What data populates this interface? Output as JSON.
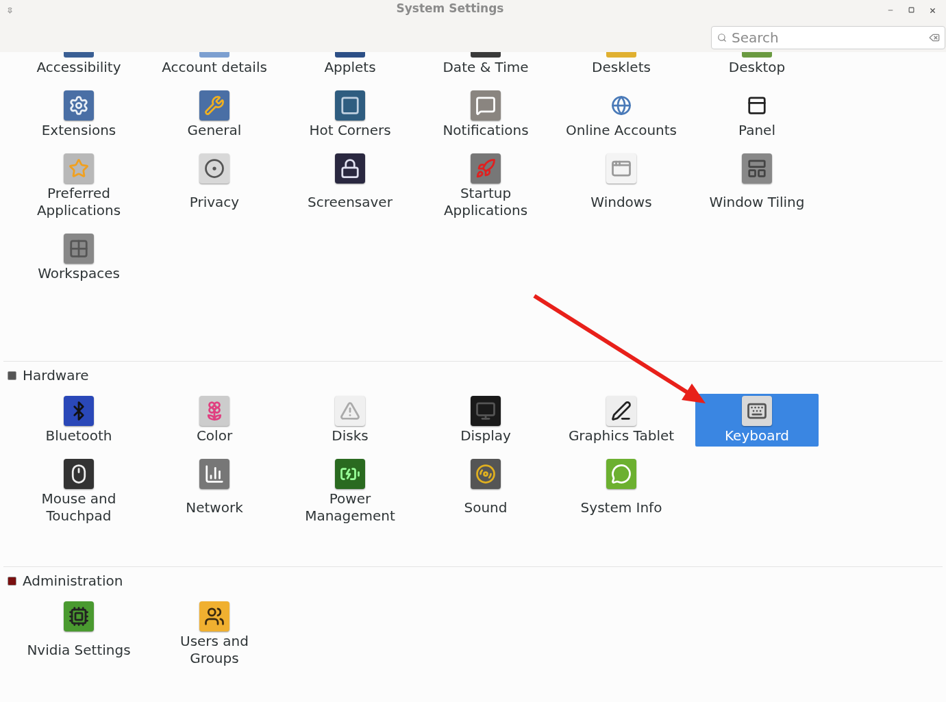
{
  "window": {
    "title": "System Settings"
  },
  "search": {
    "placeholder": "Search"
  },
  "sections": [
    {
      "items": [
        {
          "label": "Accessibility",
          "selected": false
        },
        {
          "label": "Account details",
          "selected": false
        },
        {
          "label": "Applets",
          "selected": false
        },
        {
          "label": "Date & Time",
          "selected": false
        },
        {
          "label": "Desklets",
          "selected": false
        },
        {
          "label": "Desktop",
          "selected": false
        },
        {
          "label": "Extensions",
          "selected": false
        },
        {
          "label": "General",
          "selected": false
        },
        {
          "label": "Hot Corners",
          "selected": false
        },
        {
          "label": "Notifications",
          "selected": false
        },
        {
          "label": "Online Accounts",
          "selected": false
        },
        {
          "label": "Panel",
          "selected": false
        },
        {
          "label": "Preferred\nApplications",
          "selected": false
        },
        {
          "label": "Privacy",
          "selected": false
        },
        {
          "label": "Screensaver",
          "selected": false
        },
        {
          "label": "Startup\nApplications",
          "selected": false
        },
        {
          "label": "Windows",
          "selected": false
        },
        {
          "label": "Window Tiling",
          "selected": false
        },
        {
          "label": "Workspaces",
          "selected": false
        }
      ]
    },
    {
      "title": "Hardware",
      "items": [
        {
          "label": "Bluetooth",
          "selected": false
        },
        {
          "label": "Color",
          "selected": false
        },
        {
          "label": "Disks",
          "selected": false
        },
        {
          "label": "Display",
          "selected": false
        },
        {
          "label": "Graphics Tablet",
          "selected": false
        },
        {
          "label": "Keyboard",
          "selected": true
        },
        {
          "label": "Mouse and\nTouchpad",
          "selected": false
        },
        {
          "label": "Network",
          "selected": false
        },
        {
          "label": "Power\nManagement",
          "selected": false
        },
        {
          "label": "Sound",
          "selected": false
        },
        {
          "label": "System Info",
          "selected": false
        }
      ]
    },
    {
      "title": "Administration",
      "items": [
        {
          "label": "Nvidia Settings",
          "selected": false
        },
        {
          "label": "Users and\nGroups",
          "selected": false
        }
      ]
    }
  ]
}
